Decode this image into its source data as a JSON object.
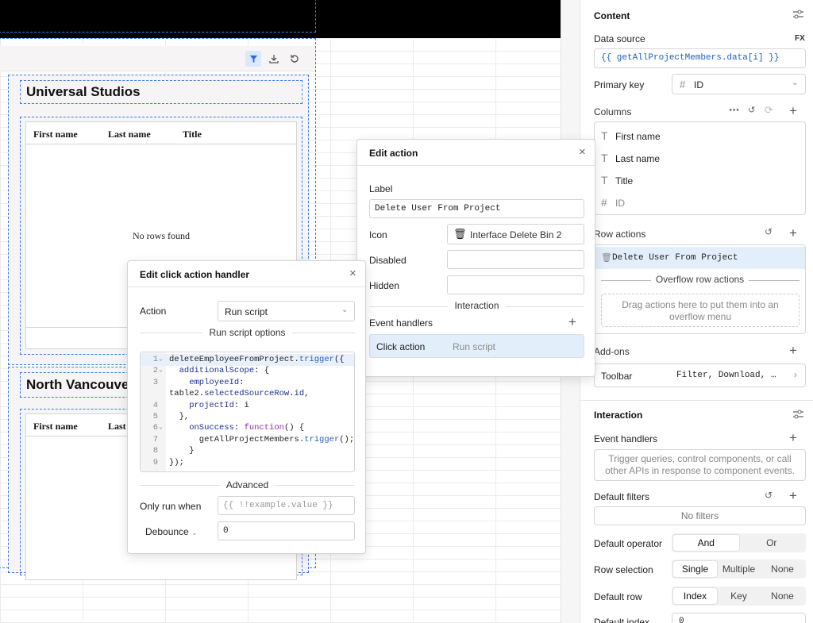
{
  "canvas": {
    "container1": {
      "title": "Universal Studios",
      "columns": [
        "First name",
        "Last name",
        "Title"
      ],
      "empty_text": "No rows found"
    },
    "container2": {
      "title": "North Vancouve",
      "columns": [
        "First name",
        "Last n"
      ]
    },
    "toolbar_icons": [
      "filter-icon",
      "download-icon",
      "refresh-icon"
    ]
  },
  "edit_action": {
    "title": "Edit action",
    "label_label": "Label",
    "label_value": "Delete User From Project",
    "icon_label": "Icon",
    "icon_value": "Interface Delete Bin 2",
    "disabled_label": "Disabled",
    "disabled_value": "",
    "hidden_label": "Hidden",
    "hidden_value": "",
    "interaction_label": "Interaction",
    "event_handlers_label": "Event handlers",
    "handler_event": "Click action",
    "handler_action": "Run script"
  },
  "click_handler": {
    "title": "Edit click action handler",
    "action_label": "Action",
    "action_value": "Run script",
    "options_label": "Run script options",
    "code_lines": [
      "1",
      "2",
      "3",
      "",
      "4",
      "5",
      "6",
      "7",
      "8",
      "9"
    ],
    "advanced_label": "Advanced",
    "only_run_label": "Only run when",
    "only_run_placeholder": "{{ !!example.value }}",
    "debounce_label": "Debounce",
    "debounce_value": "0"
  },
  "inspector": {
    "content_title": "Content",
    "data_source_label": "Data source",
    "data_source_fx": "FX",
    "data_source_value": "{{ getAllProjectMembers.data[i] }}",
    "primary_key_label": "Primary key",
    "primary_key_value": "ID",
    "columns_label": "Columns",
    "columns": [
      {
        "type": "T",
        "name": "First name"
      },
      {
        "type": "T",
        "name": "Last name"
      },
      {
        "type": "T",
        "name": "Title"
      },
      {
        "type": "#",
        "name": "ID"
      }
    ],
    "row_actions_label": "Row actions",
    "row_action_item": "Delete User From Project",
    "overflow_label": "Overflow row actions",
    "overflow_hint": "Drag actions here to put them into an overflow menu",
    "addons_label": "Add-ons",
    "toolbar_label": "Toolbar",
    "toolbar_value": "Filter, Download, …",
    "interaction_title": "Interaction",
    "event_handlers_label": "Event handlers",
    "event_handlers_hint": "Trigger queries, control components, or call other APIs in response to component events.",
    "default_filters_label": "Default filters",
    "no_filters": "No filters",
    "default_operator_label": "Default operator",
    "operator_options": [
      "And",
      "Or"
    ],
    "row_selection_label": "Row selection",
    "row_selection_options": [
      "Single",
      "Multiple",
      "None"
    ],
    "default_row_label": "Default row",
    "default_row_options": [
      "Index",
      "Key",
      "None"
    ],
    "default_index_label": "Default index",
    "default_index_value": "0"
  }
}
